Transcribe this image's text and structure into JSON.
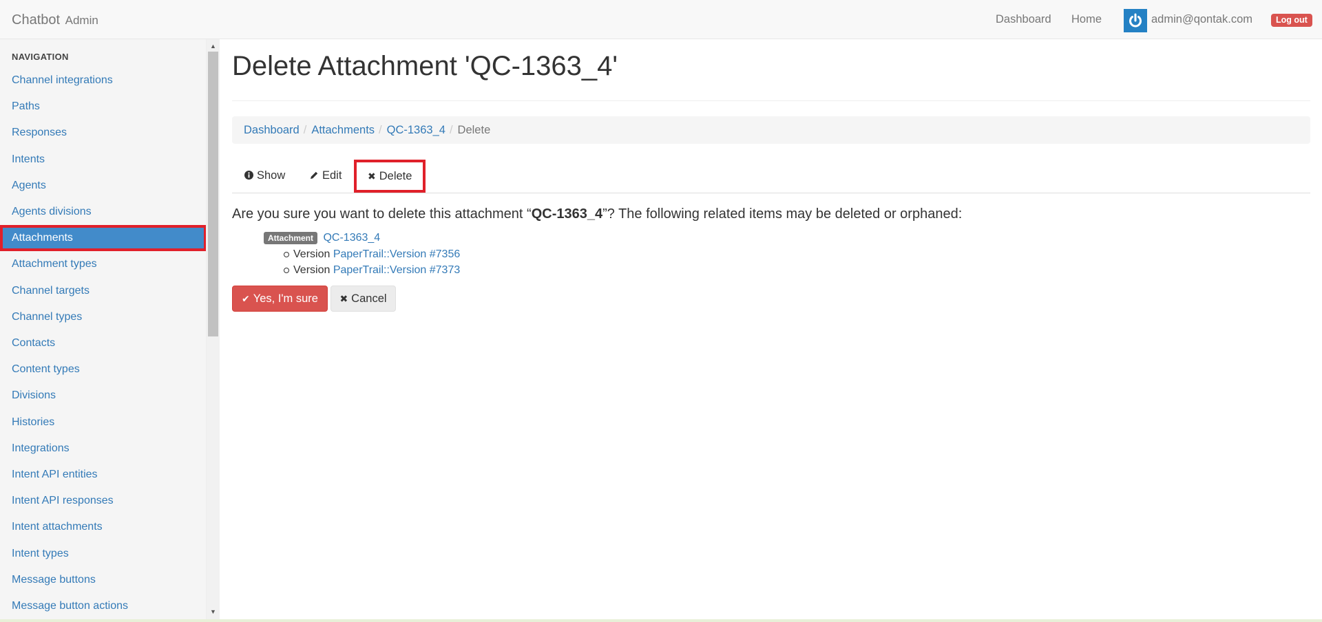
{
  "navbar": {
    "brand": "Chatbot",
    "brand_sub": "Admin",
    "links": {
      "dashboard": "Dashboard",
      "home": "Home"
    },
    "user_email": "admin@qontak.com",
    "logout": "Log out"
  },
  "sidebar": {
    "header": "NAVIGATION",
    "items": [
      {
        "label": "Channel integrations"
      },
      {
        "label": "Paths"
      },
      {
        "label": "Responses"
      },
      {
        "label": "Intents"
      },
      {
        "label": "Agents"
      },
      {
        "label": "Agents divisions"
      },
      {
        "label": "Attachments",
        "active": true
      },
      {
        "label": "Attachment types"
      },
      {
        "label": "Channel targets"
      },
      {
        "label": "Channel types"
      },
      {
        "label": "Contacts"
      },
      {
        "label": "Content types"
      },
      {
        "label": "Divisions"
      },
      {
        "label": "Histories"
      },
      {
        "label": "Integrations"
      },
      {
        "label": "Intent API entities"
      },
      {
        "label": "Intent API responses"
      },
      {
        "label": "Intent attachments"
      },
      {
        "label": "Intent types"
      },
      {
        "label": "Message buttons"
      },
      {
        "label": "Message button actions"
      }
    ]
  },
  "main": {
    "title": "Delete Attachment 'QC-1363_4'",
    "breadcrumb": [
      "Dashboard",
      "Attachments",
      "QC-1363_4",
      "Delete"
    ],
    "tabs": {
      "show": "Show",
      "edit": "Edit",
      "delete": "Delete"
    },
    "question_pre": "Are you sure you want to delete this attachment “",
    "question_name": "QC-1363_4",
    "question_post": "”? The following related items may be deleted or orphaned:",
    "related": {
      "badge": "Attachment",
      "name": "QC-1363_4",
      "versions": [
        {
          "prefix": "Version",
          "link": "PaperTrail::Version #7356"
        },
        {
          "prefix": "Version",
          "link": "PaperTrail::Version #7373"
        }
      ]
    },
    "confirm_button": "Yes, I'm sure",
    "cancel_button": "Cancel"
  },
  "colors": {
    "accent": "#428bca",
    "link": "#337ab7",
    "danger": "#d9534f",
    "highlight_border": "#e0202a"
  }
}
